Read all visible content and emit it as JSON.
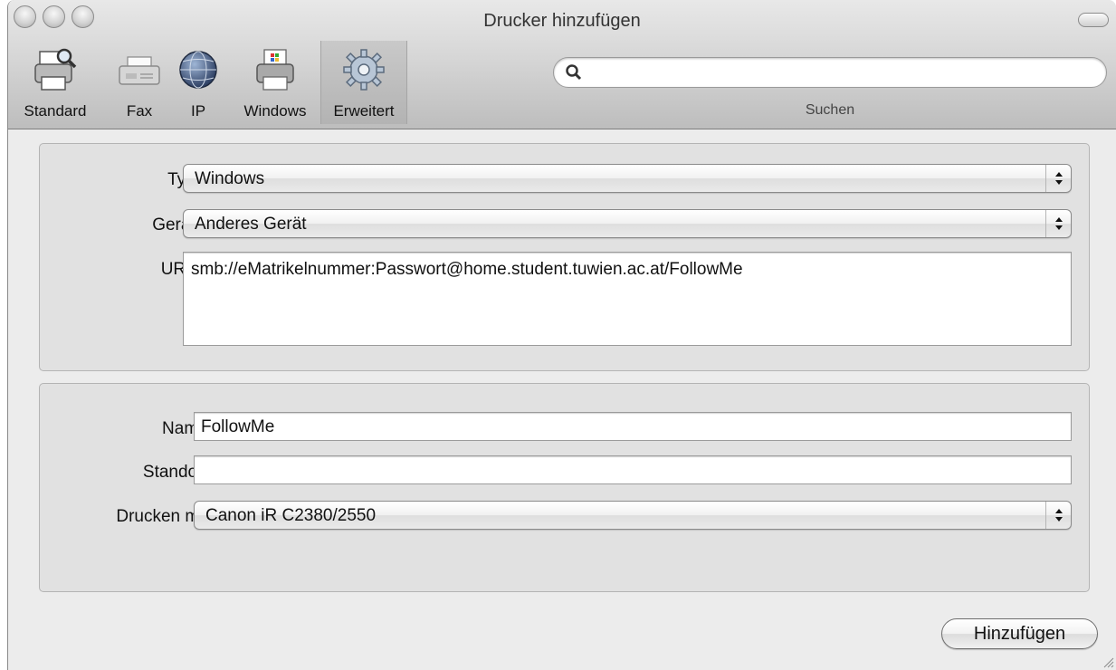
{
  "window": {
    "title": "Drucker hinzufügen"
  },
  "toolbar": {
    "items": [
      {
        "label": "Standard",
        "icon": "printer-magnifier-icon"
      },
      {
        "label": "Fax",
        "icon": "fax-icon"
      },
      {
        "label": "IP",
        "icon": "globe-icon"
      },
      {
        "label": "Windows",
        "icon": "windows-printer-icon"
      },
      {
        "label": "Erweitert",
        "icon": "gear-icon",
        "selected": true
      }
    ],
    "search": {
      "value": "",
      "label": "Suchen"
    }
  },
  "connection": {
    "type_label": "Typ:",
    "type_value": "Windows",
    "device_label": "Gerät:",
    "device_value": "Anderes Gerät",
    "url_label": "URL:",
    "url_value": "smb://eMatrikelnummer:Passwort@home.student.tuwien.ac.at/FollowMe"
  },
  "details": {
    "name_label": "Name:",
    "name_value": "FollowMe",
    "location_label": "Standort:",
    "location_value": "",
    "driver_label": "Drucken mit:",
    "driver_value": "Canon iR C2380/2550"
  },
  "actions": {
    "add_label": "Hinzufügen"
  }
}
